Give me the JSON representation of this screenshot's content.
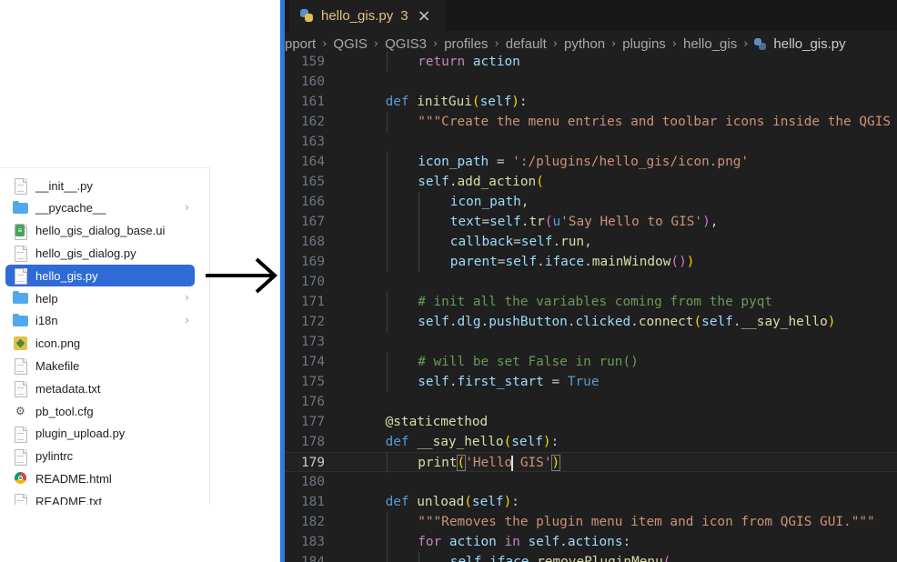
{
  "finder": {
    "items": [
      {
        "name": "__init__.py",
        "icon": "python-file-icon",
        "folder": false
      },
      {
        "name": "__pycache__",
        "icon": "folder-icon",
        "folder": true
      },
      {
        "name": "hello_gis_dialog_base.ui",
        "icon": "ui-file-icon",
        "folder": false
      },
      {
        "name": "hello_gis_dialog.py",
        "icon": "python-file-icon",
        "folder": false
      },
      {
        "name": "hello_gis.py",
        "icon": "python-file-icon",
        "folder": false,
        "selected": true
      },
      {
        "name": "help",
        "icon": "folder-icon",
        "folder": true
      },
      {
        "name": "i18n",
        "icon": "folder-icon",
        "folder": true
      },
      {
        "name": "icon.png",
        "icon": "image-file-icon",
        "folder": false
      },
      {
        "name": "Makefile",
        "icon": "document-icon",
        "folder": false
      },
      {
        "name": "metadata.txt",
        "icon": "text-file-icon",
        "folder": false
      },
      {
        "name": "pb_tool.cfg",
        "icon": "gear-icon",
        "folder": false
      },
      {
        "name": "plugin_upload.py",
        "icon": "python-file-icon",
        "folder": false
      },
      {
        "name": "pylintrc",
        "icon": "document-icon",
        "folder": false
      },
      {
        "name": "README.html",
        "icon": "chrome-icon",
        "folder": false
      },
      {
        "name": "README.txt",
        "icon": "text-file-icon",
        "folder": false
      }
    ],
    "selected_color": "#2f6ad9"
  },
  "arrow": {
    "icon": "right-arrow-icon"
  },
  "editor": {
    "tab": {
      "filename": "hello_gis.py",
      "problem_count": "3",
      "close_glyph": "×"
    },
    "breadcrumb": [
      "pport",
      "QGIS",
      "QGIS3",
      "profiles",
      "default",
      "python",
      "plugins",
      "hello_gis",
      "hello_gis.py"
    ],
    "breadcrumb_sep": "›",
    "active_line": "179",
    "lines": [
      {
        "n": "159",
        "i": 2,
        "t": [
          [
            "ctl",
            "return"
          ],
          [
            "df",
            " "
          ],
          [
            "va",
            "action"
          ]
        ]
      },
      {
        "n": "160",
        "i": 0,
        "t": []
      },
      {
        "n": "161",
        "i": 1,
        "t": [
          [
            "kw",
            "def"
          ],
          [
            "df",
            " "
          ],
          [
            "fn",
            "initGui"
          ],
          [
            "b1",
            "("
          ],
          [
            "va",
            "self"
          ],
          [
            "b1",
            ")"
          ],
          [
            "df",
            ":"
          ]
        ]
      },
      {
        "n": "162",
        "i": 2,
        "t": [
          [
            "st",
            "\"\"\"Create the menu entries and toolbar icons inside the QGIS GUI.\"\"\""
          ]
        ]
      },
      {
        "n": "163",
        "i": 0,
        "t": []
      },
      {
        "n": "164",
        "i": 2,
        "t": [
          [
            "va",
            "icon_path"
          ],
          [
            "df",
            " = "
          ],
          [
            "st",
            "':/plugins/hello_gis/icon.png'"
          ]
        ]
      },
      {
        "n": "165",
        "i": 2,
        "t": [
          [
            "va",
            "self"
          ],
          [
            "df",
            "."
          ],
          [
            "fn",
            "add_action"
          ],
          [
            "b1",
            "("
          ]
        ]
      },
      {
        "n": "166",
        "i": 3,
        "t": [
          [
            "va",
            "icon_path"
          ],
          [
            "df",
            ","
          ]
        ]
      },
      {
        "n": "167",
        "i": 3,
        "t": [
          [
            "va",
            "text"
          ],
          [
            "df",
            "="
          ],
          [
            "va",
            "self"
          ],
          [
            "df",
            "."
          ],
          [
            "fn",
            "tr"
          ],
          [
            "b2",
            "("
          ],
          [
            "kw",
            "u"
          ],
          [
            "st",
            "'Say Hello to GIS'"
          ],
          [
            "b2",
            ")"
          ],
          [
            "df",
            ","
          ]
        ]
      },
      {
        "n": "168",
        "i": 3,
        "t": [
          [
            "va",
            "callback"
          ],
          [
            "df",
            "="
          ],
          [
            "va",
            "self"
          ],
          [
            "df",
            "."
          ],
          [
            "fn",
            "run"
          ],
          [
            "df",
            ","
          ]
        ]
      },
      {
        "n": "169",
        "i": 3,
        "t": [
          [
            "va",
            "parent"
          ],
          [
            "df",
            "="
          ],
          [
            "va",
            "self"
          ],
          [
            "df",
            "."
          ],
          [
            "va",
            "iface"
          ],
          [
            "df",
            "."
          ],
          [
            "fn",
            "mainWindow"
          ],
          [
            "b2",
            "("
          ],
          [
            "b2",
            ")"
          ],
          [
            "b1",
            ")"
          ]
        ]
      },
      {
        "n": "170",
        "i": 0,
        "t": []
      },
      {
        "n": "171",
        "i": 2,
        "t": [
          [
            "cm",
            "# init all the variables coming from the pyqt"
          ]
        ]
      },
      {
        "n": "172",
        "i": 2,
        "t": [
          [
            "va",
            "self"
          ],
          [
            "df",
            "."
          ],
          [
            "va",
            "dlg"
          ],
          [
            "df",
            "."
          ],
          [
            "va",
            "pushButton"
          ],
          [
            "df",
            "."
          ],
          [
            "va",
            "clicked"
          ],
          [
            "df",
            "."
          ],
          [
            "fn",
            "connect"
          ],
          [
            "b1",
            "("
          ],
          [
            "va",
            "self"
          ],
          [
            "df",
            "."
          ],
          [
            "fn",
            "__say_hello"
          ],
          [
            "b1",
            ")"
          ]
        ]
      },
      {
        "n": "173",
        "i": 0,
        "t": []
      },
      {
        "n": "174",
        "i": 2,
        "t": [
          [
            "cm",
            "# will be set False in run()"
          ]
        ]
      },
      {
        "n": "175",
        "i": 2,
        "t": [
          [
            "va",
            "self"
          ],
          [
            "df",
            "."
          ],
          [
            "va",
            "first_start"
          ],
          [
            "df",
            " = "
          ],
          [
            "kw",
            "True"
          ]
        ]
      },
      {
        "n": "176",
        "i": 0,
        "t": []
      },
      {
        "n": "177",
        "i": 1,
        "t": [
          [
            "fn",
            "@staticmethod"
          ]
        ]
      },
      {
        "n": "178",
        "i": 1,
        "t": [
          [
            "kw",
            "def"
          ],
          [
            "df",
            " "
          ],
          [
            "fn",
            "__say_hello"
          ],
          [
            "b1",
            "("
          ],
          [
            "va",
            "self"
          ],
          [
            "b1",
            ")"
          ],
          [
            "df",
            ":"
          ]
        ]
      },
      {
        "n": "179",
        "i": 2,
        "t": [
          [
            "fn",
            "print"
          ],
          [
            "b1",
            "("
          ],
          [
            "st",
            "'Hello"
          ],
          [
            "cursor",
            ""
          ],
          [
            "st",
            " GIS'"
          ],
          [
            "b1",
            ")"
          ]
        ]
      },
      {
        "n": "180",
        "i": 0,
        "t": []
      },
      {
        "n": "181",
        "i": 1,
        "t": [
          [
            "kw",
            "def"
          ],
          [
            "df",
            " "
          ],
          [
            "fn",
            "unload"
          ],
          [
            "b1",
            "("
          ],
          [
            "va",
            "self"
          ],
          [
            "b1",
            ")"
          ],
          [
            "df",
            ":"
          ]
        ]
      },
      {
        "n": "182",
        "i": 2,
        "t": [
          [
            "st",
            "\"\"\"Removes the plugin menu item and icon from QGIS GUI.\"\"\""
          ]
        ]
      },
      {
        "n": "183",
        "i": 2,
        "t": [
          [
            "ctl",
            "for"
          ],
          [
            "df",
            " "
          ],
          [
            "va",
            "action"
          ],
          [
            "df",
            " "
          ],
          [
            "ctl",
            "in"
          ],
          [
            "df",
            " "
          ],
          [
            "va",
            "self"
          ],
          [
            "df",
            "."
          ],
          [
            "va",
            "actions"
          ],
          [
            "df",
            ":"
          ]
        ]
      },
      {
        "n": "184",
        "i": 3,
        "t": [
          [
            "va",
            "self"
          ],
          [
            "df",
            "."
          ],
          [
            "va",
            "iface"
          ],
          [
            "df",
            "."
          ],
          [
            "fn",
            "removePluginMenu"
          ],
          [
            "b2",
            "("
          ]
        ]
      }
    ]
  }
}
